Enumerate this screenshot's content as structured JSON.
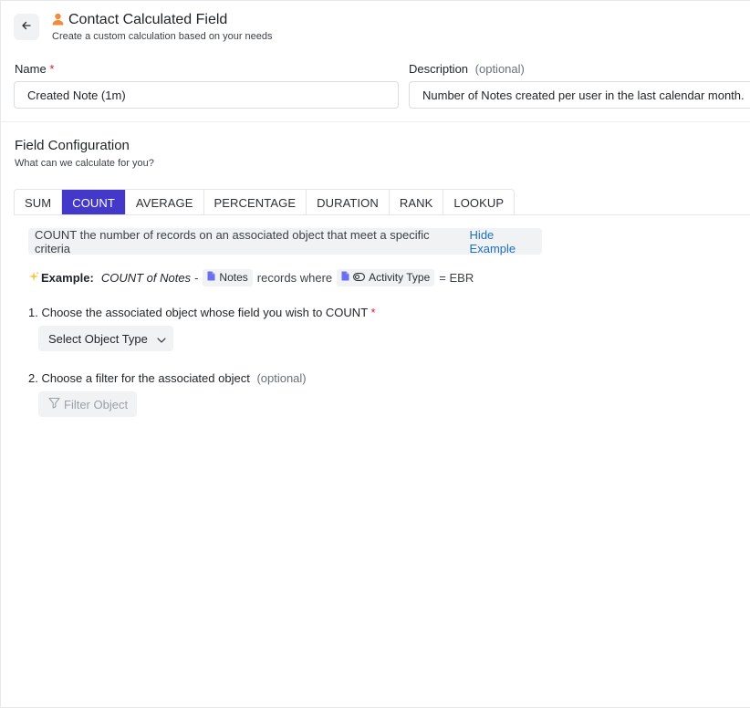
{
  "header": {
    "title": "Contact Calculated Field",
    "subtitle": "Create a custom calculation based on your needs",
    "icon": "person-icon",
    "icon_color": "#f08c3a"
  },
  "form": {
    "name_label": "Name",
    "name_required": "*",
    "name_value": "Created Note (1m)",
    "description_label": "Description",
    "description_optional": "(optional)",
    "description_value": "Number of Notes created per user in the last calendar month."
  },
  "config": {
    "title": "Field Configuration",
    "subtitle": "What can we calculate for you?",
    "tabs": [
      {
        "label": "SUM",
        "active": false
      },
      {
        "label": "COUNT",
        "active": true
      },
      {
        "label": "AVERAGE",
        "active": false
      },
      {
        "label": "PERCENTAGE",
        "active": false
      },
      {
        "label": "DURATION",
        "active": false
      },
      {
        "label": "RANK",
        "active": false
      },
      {
        "label": "LOOKUP",
        "active": false
      }
    ],
    "accent_color": "#4338ca"
  },
  "hint": {
    "text": "COUNT the number of records on an associated object that meet a specific criteria",
    "link": "Hide Example"
  },
  "example": {
    "label": "Example:",
    "func": "COUNT of Notes",
    "dash": "-",
    "object_chip": "Notes",
    "records_where": "records where",
    "field_chip": "Activity Type",
    "equals": "= EBR"
  },
  "step1": {
    "label": "1. Choose the associated object whose field you wish to COUNT",
    "required": "*",
    "button": "Select Object Type"
  },
  "step2": {
    "label": "2. Choose a filter for the associated object",
    "optional": "(optional)",
    "button": "Filter Object"
  }
}
